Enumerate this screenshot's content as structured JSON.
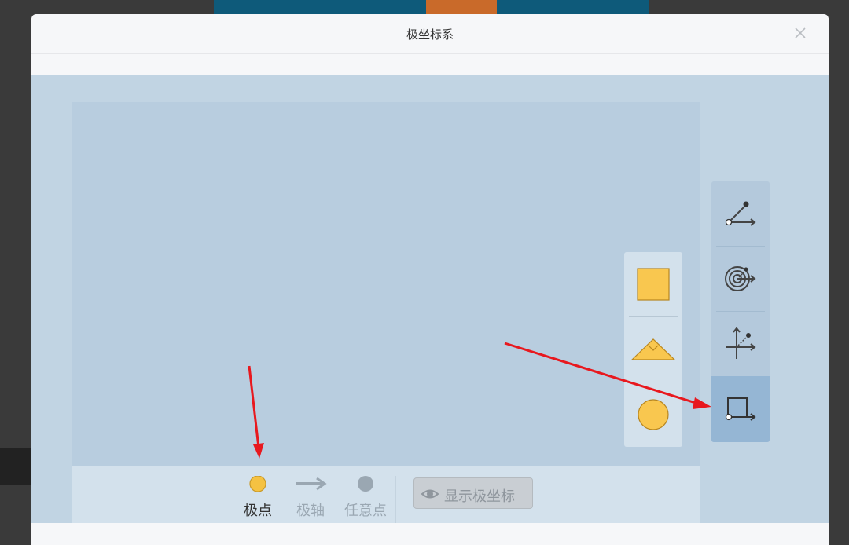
{
  "dialog": {
    "title": "极坐标系",
    "close_icon": "close-icon"
  },
  "bottom_bar": {
    "items": [
      {
        "label": "极点",
        "icon": "pole-point-icon",
        "color": "#f5c242",
        "enabled": true
      },
      {
        "label": "极轴",
        "icon": "polar-axis-arrow-icon",
        "enabled": false
      },
      {
        "label": "任意点",
        "icon": "arbitrary-point-icon",
        "enabled": false
      }
    ],
    "show_button_label": "显示极坐标",
    "show_button_icon": "eye-icon"
  },
  "shape_panel": {
    "items": [
      {
        "name": "square",
        "icon": "square-shape-icon"
      },
      {
        "name": "roof-triangle",
        "icon": "triangle-shape-icon"
      },
      {
        "name": "circle",
        "icon": "circle-shape-icon"
      }
    ],
    "fill_color": "#f9c74f"
  },
  "tool_panel": {
    "items": [
      {
        "name": "polar-angle",
        "icon": "polar-angle-icon",
        "active": false
      },
      {
        "name": "polar-target",
        "icon": "polar-target-icon",
        "active": false
      },
      {
        "name": "cartesian-point",
        "icon": "cartesian-point-icon",
        "active": false
      },
      {
        "name": "rectangle-axis",
        "icon": "rectangle-axis-icon",
        "active": true
      }
    ]
  },
  "colors": {
    "content_bg": "#c1d4e3",
    "canvas_bg": "#b8cddf",
    "accent": "#f9c74f",
    "annotation_arrow": "#e8181e"
  }
}
